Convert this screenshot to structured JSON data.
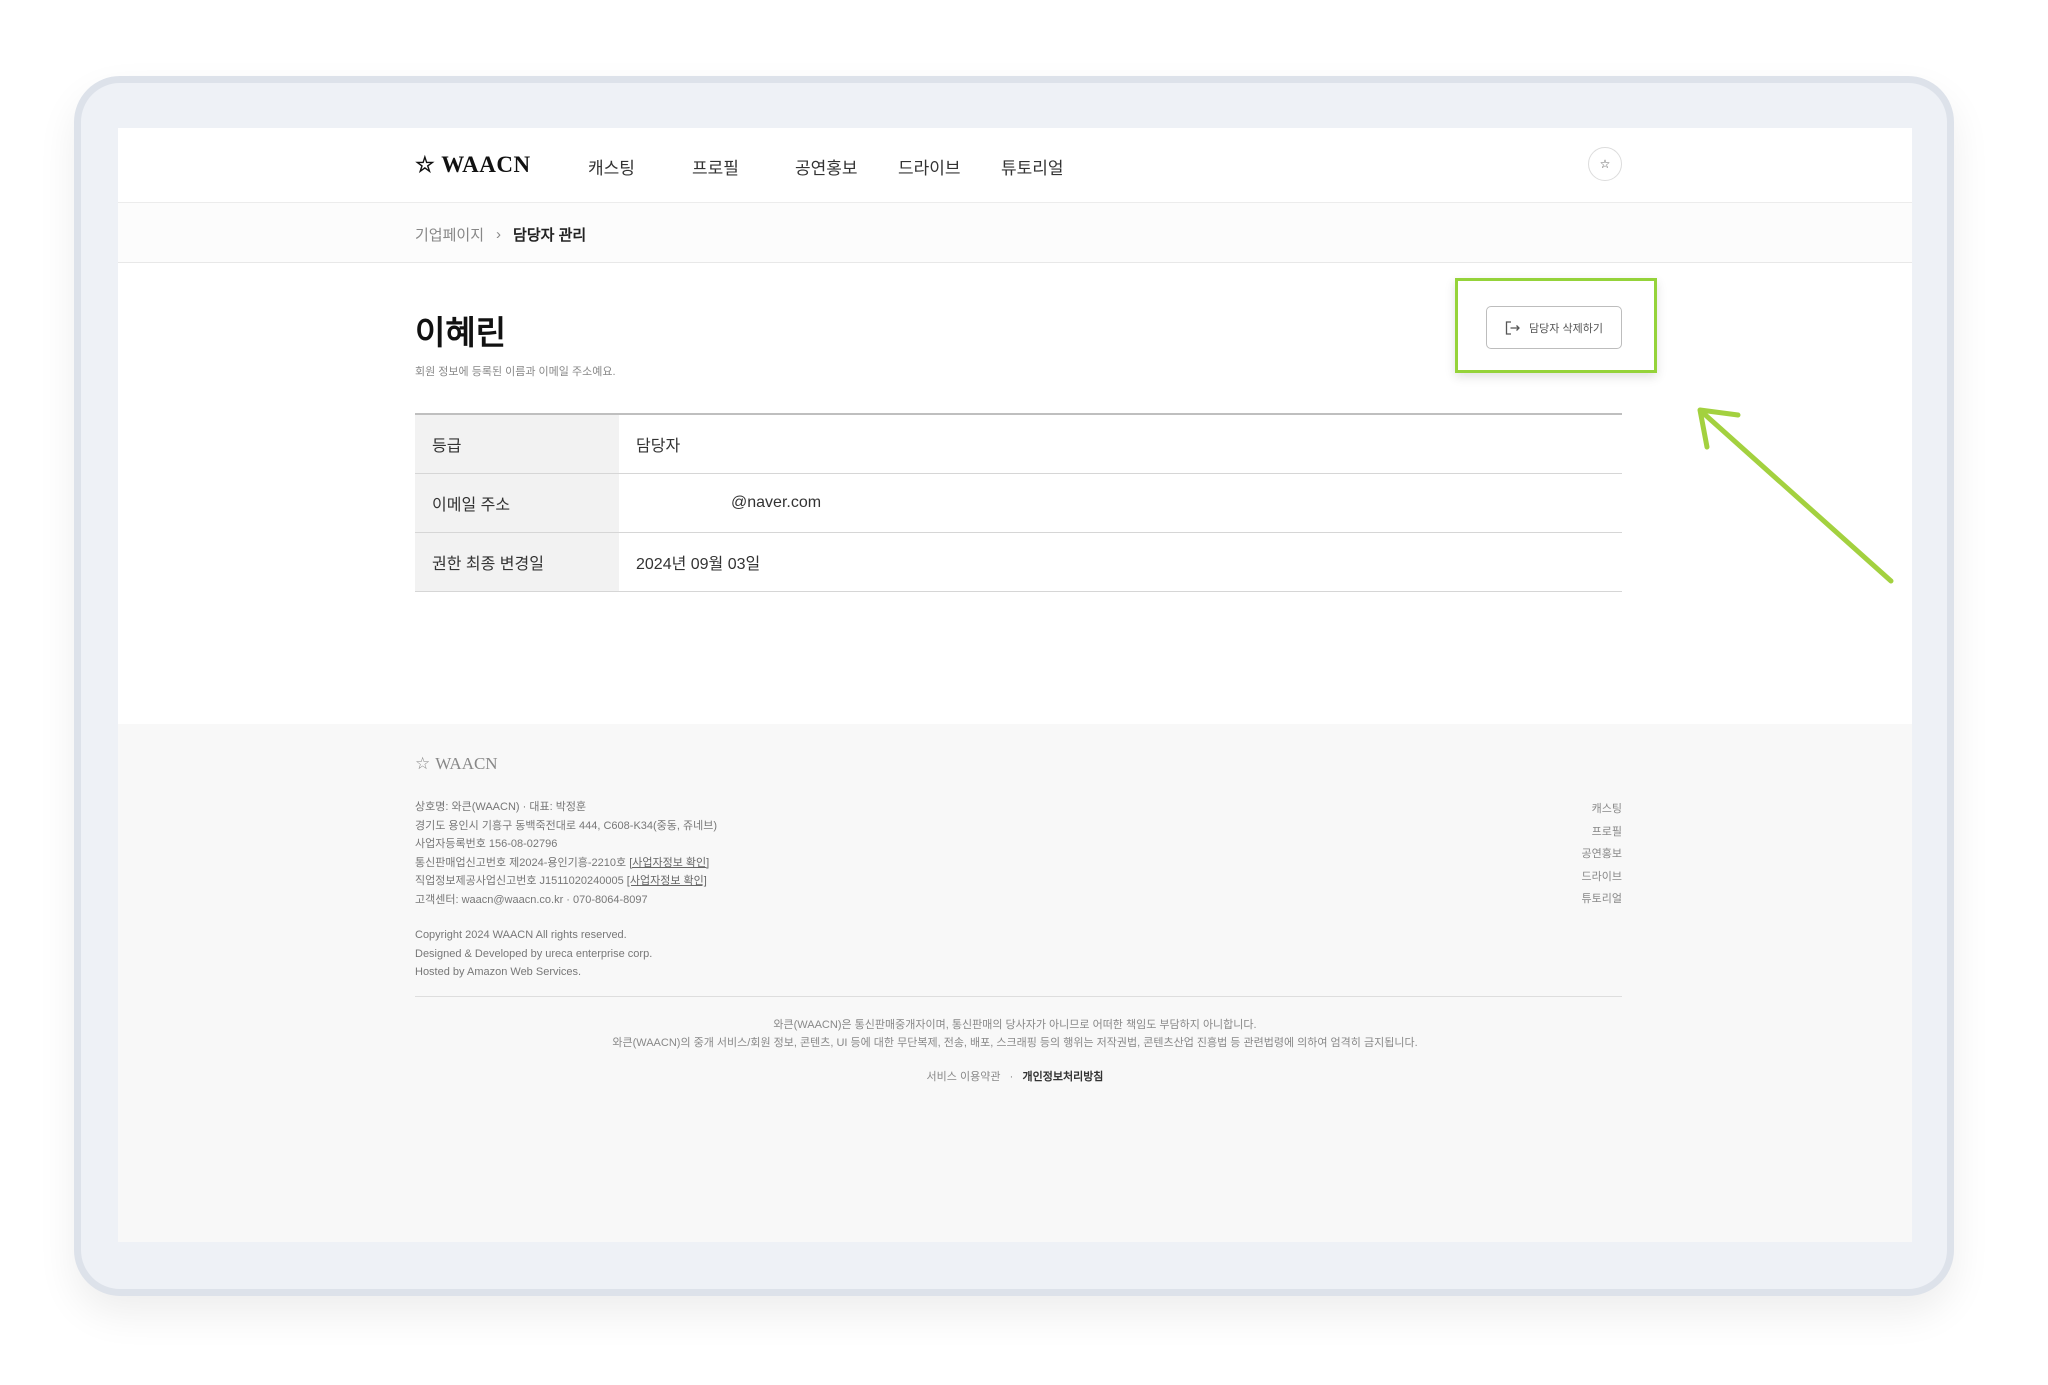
{
  "header": {
    "logo_text": "WAACN",
    "nav": [
      "캐스팅",
      "프로필",
      "공연홍보",
      "드라이브",
      "튜토리얼"
    ]
  },
  "breadcrumb": {
    "parent": "기업페이지",
    "separator": "›",
    "current": "담당자 관리"
  },
  "profile": {
    "name": "이혜린",
    "description": "회원 정보에 등록된 이름과 이메일 주소예요.",
    "delete_button": "담당자 삭제하기"
  },
  "info_table": [
    {
      "label": "등급",
      "value": "담당자"
    },
    {
      "label": "이메일 주소",
      "value": "@naver.com"
    },
    {
      "label": "권한 최종 변경일",
      "value": "2024년 09월 03일"
    }
  ],
  "footer": {
    "logo_text": "WAACN",
    "company_info": [
      "상호명: 와큰(WAACN) · 대표: 박정훈",
      "경기도 용인시 기흥구 동백죽전대로 444, C608-K34(중동, 쥬네브)",
      "사업자등록번호 156-08-02796",
      "통신판매업신고번호 제2024-용인기흥-2210호",
      "직업정보제공사업신고번호 J1511020240005",
      "고객센터: waacn@waacn.co.kr · 070-8064-8097"
    ],
    "business_link": "[사업자정보 확인]",
    "copyright": [
      "Copyright 2024 WAACN All rights reserved.",
      "Designed & Developed by ureca enterprise corp.",
      "Hosted by Amazon Web Services."
    ],
    "links": [
      "캐스팅",
      "프로필",
      "공연홍보",
      "드라이브",
      "튜토리얼"
    ],
    "notice": [
      "와큰(WAACN)은 통신판매중개자이며, 통신판매의 당사자가 아니므로 어떠한 책임도 부담하지 아니합니다.",
      "와큰(WAACN)의 중개 서비스/회원 정보, 콘텐츠, UI 등에 대한 무단복제, 전송, 배포, 스크래핑 등의 행위는 저작권법, 콘텐츠산업 진흥법 등 관련법령에 의하여 엄격히 금지됩니다."
    ],
    "terms": "서비스 이용약관",
    "policy_separator": "·",
    "privacy": "개인정보처리방침"
  },
  "colors": {
    "highlight": "#95d33a",
    "arrow": "#a3d13f"
  }
}
